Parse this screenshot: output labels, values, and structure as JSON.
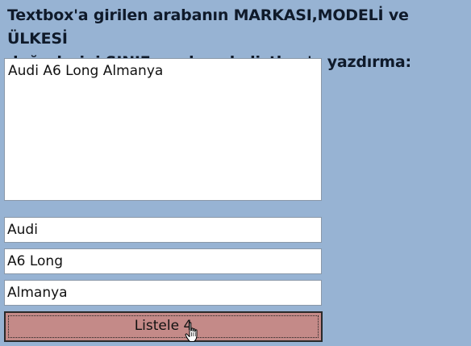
{
  "header": {
    "title_line1": "Textbox'a girilen arabanın MARKASI,MODELİ ve ÜLKESİ",
    "title_line2": "değerlerini SINIF yardımıyla listbox'a yazdırma:"
  },
  "listbox": {
    "items": [
      "Audi A6 Long Almanya"
    ]
  },
  "inputs": {
    "make": "Audi",
    "model": "A6 Long",
    "country": "Almanya"
  },
  "button": {
    "label": "Listele 4"
  },
  "icons": {
    "cursor": "hand-pointer-icon"
  },
  "colors": {
    "background": "#97b3d3",
    "button": "#c48a88"
  }
}
